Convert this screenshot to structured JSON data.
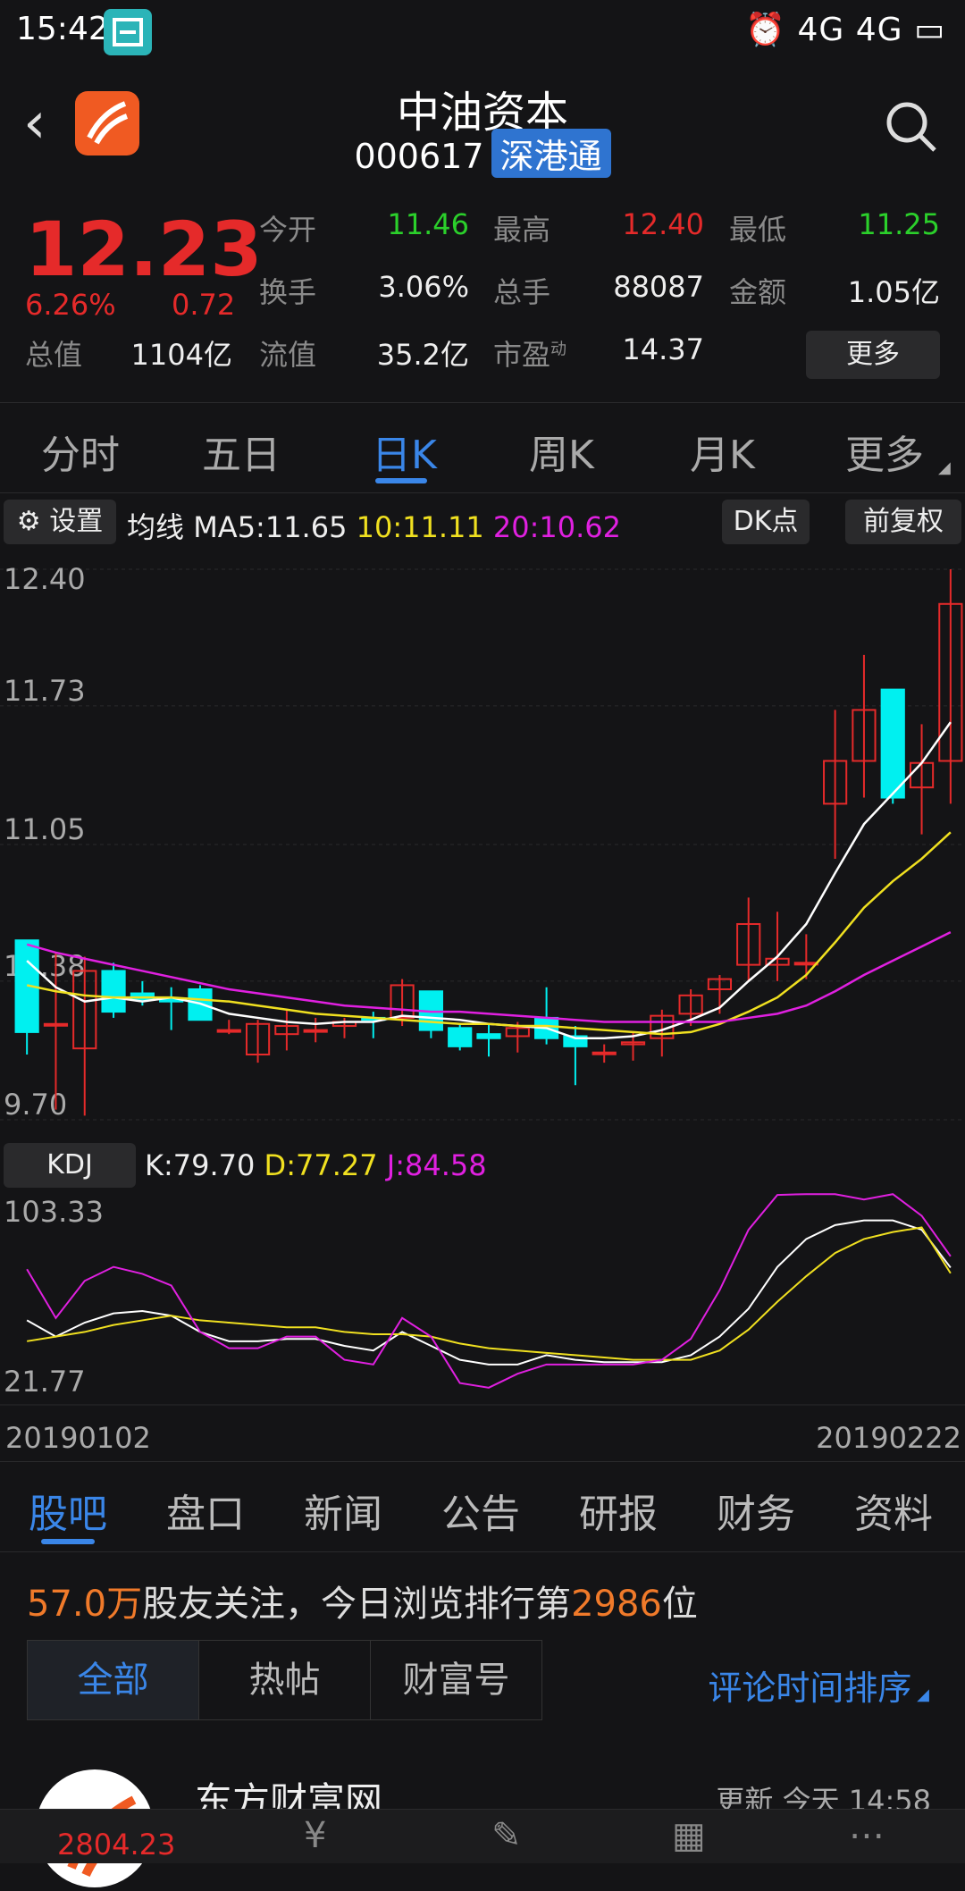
{
  "status_bar": {
    "time": "15:42",
    "right": "4G 4G"
  },
  "header": {
    "title": "中油资本",
    "code": "000617",
    "tag": "深港通"
  },
  "quote": {
    "price": "12.23",
    "change_pct": "6.26%",
    "change": "0.72",
    "open_label": "今开",
    "open": "11.46",
    "high_label": "最高",
    "high": "12.40",
    "low_label": "最低",
    "low": "11.25",
    "turnover_label": "换手",
    "turnover": "3.06%",
    "volume_label": "总手",
    "volume": "88087",
    "amount_label": "金额",
    "amount": "1.05亿",
    "mktcap_label": "总值",
    "mktcap": "1104亿",
    "float_label": "流值",
    "float": "35.2亿",
    "pe_label": "市盈",
    "pe_sup": "动",
    "pe": "14.37",
    "more": "更多"
  },
  "tabs": [
    "分时",
    "五日",
    "日K",
    "周K",
    "月K",
    "更多"
  ],
  "chart_toolbar": {
    "settings": "设置",
    "ma_label": "均线",
    "ma5": "MA5:11.65",
    "ma10": "10:11.11",
    "ma20": "20:10.62",
    "dk": "DK点",
    "adjust": "前复权"
  },
  "kdj_toolbar": {
    "label": "KDJ",
    "k": "K:79.70",
    "d": "D:77.27",
    "j": "J:84.58"
  },
  "dates": {
    "start": "20190102",
    "end": "20190222"
  },
  "colors": {
    "up": "#e52a2a",
    "down": "#00f0f0",
    "ma5": "#ffffff",
    "ma10": "#f0e020",
    "ma20": "#e020e0",
    "accent": "#3a86e8"
  },
  "chart_data": [
    {
      "type": "candlestick",
      "y_ticks": [
        "12.40",
        "11.73",
        "11.05",
        "10.38",
        "9.70"
      ],
      "ylim": [
        9.7,
        12.4
      ],
      "candles": [
        [
          10.58,
          10.58,
          10.02,
          10.13
        ],
        [
          10.17,
          10.52,
          9.75,
          10.17
        ],
        [
          10.05,
          10.5,
          9.72,
          10.43
        ],
        [
          10.43,
          10.47,
          10.2,
          10.23
        ],
        [
          10.32,
          10.38,
          10.26,
          10.29
        ],
        [
          10.29,
          10.35,
          10.14,
          10.28
        ],
        [
          10.34,
          10.36,
          10.19,
          10.19
        ],
        [
          10.14,
          10.19,
          10.12,
          10.14
        ],
        [
          10.02,
          10.19,
          9.98,
          10.17
        ],
        [
          10.12,
          10.24,
          10.04,
          10.16
        ],
        [
          10.14,
          10.2,
          10.08,
          10.14
        ],
        [
          10.16,
          10.2,
          10.1,
          10.18
        ],
        [
          10.2,
          10.23,
          10.1,
          10.19
        ],
        [
          10.2,
          10.39,
          10.16,
          10.36
        ],
        [
          10.33,
          10.33,
          10.1,
          10.14
        ],
        [
          10.15,
          10.17,
          10.04,
          10.06
        ],
        [
          10.12,
          10.17,
          10.01,
          10.1
        ],
        [
          10.11,
          10.18,
          10.03,
          10.15
        ],
        [
          10.2,
          10.35,
          10.07,
          10.1
        ],
        [
          10.11,
          10.16,
          9.87,
          10.06
        ],
        [
          10.03,
          10.07,
          9.98,
          10.03
        ],
        [
          10.07,
          10.13,
          9.99,
          10.08
        ],
        [
          10.1,
          10.24,
          10.01,
          10.21
        ],
        [
          10.22,
          10.34,
          10.16,
          10.31
        ],
        [
          10.34,
          10.41,
          10.22,
          10.39
        ],
        [
          10.46,
          10.79,
          10.38,
          10.66
        ],
        [
          10.46,
          10.72,
          10.38,
          10.49
        ],
        [
          10.47,
          10.61,
          10.39,
          10.47
        ],
        [
          11.25,
          11.71,
          10.98,
          11.46
        ],
        [
          11.46,
          11.98,
          11.28,
          11.71
        ],
        [
          11.81,
          11.81,
          11.25,
          11.28
        ],
        [
          11.33,
          11.64,
          11.1,
          11.45
        ],
        [
          11.46,
          12.4,
          11.25,
          12.23
        ]
      ],
      "ma5": [
        10.48,
        10.35,
        10.28,
        10.3,
        10.28,
        10.3,
        10.27,
        10.22,
        10.2,
        10.18,
        10.17,
        10.18,
        10.18,
        10.21,
        10.2,
        10.19,
        10.17,
        10.16,
        10.15,
        10.1,
        10.1,
        10.11,
        10.14,
        10.19,
        10.25,
        10.38,
        10.5,
        10.66,
        10.91,
        11.15,
        11.3,
        11.45,
        11.65
      ],
      "ma10": [
        10.36,
        10.33,
        10.31,
        10.3,
        10.3,
        10.3,
        10.29,
        10.28,
        10.26,
        10.24,
        10.22,
        10.21,
        10.2,
        10.19,
        10.18,
        10.17,
        10.17,
        10.16,
        10.16,
        10.15,
        10.14,
        10.13,
        10.12,
        10.13,
        10.17,
        10.23,
        10.3,
        10.41,
        10.57,
        10.74,
        10.87,
        10.98,
        11.11
      ],
      "ma20": [
        10.56,
        10.52,
        10.49,
        10.46,
        10.43,
        10.4,
        10.37,
        10.34,
        10.32,
        10.3,
        10.28,
        10.26,
        10.25,
        10.24,
        10.23,
        10.23,
        10.22,
        10.21,
        10.2,
        10.19,
        10.18,
        10.18,
        10.18,
        10.18,
        10.18,
        10.2,
        10.22,
        10.26,
        10.33,
        10.41,
        10.48,
        10.55,
        10.62
      ]
    },
    {
      "type": "line",
      "y_ticks": [
        "103.33",
        "21.77"
      ],
      "ylim": [
        21.77,
        103.33
      ],
      "series": [
        {
          "name": "K",
          "values": [
            57,
            50,
            56,
            60,
            61,
            59,
            52,
            48,
            48,
            49,
            49,
            46,
            44,
            52,
            46,
            40,
            38,
            38,
            42,
            40,
            39,
            39,
            39,
            42,
            50,
            62,
            80,
            92,
            98,
            100,
            100,
            96,
            79.7
          ]
        },
        {
          "name": "D",
          "values": [
            48,
            50,
            52,
            55,
            57,
            59,
            57,
            56,
            55,
            54,
            54,
            52,
            51,
            51,
            50,
            47,
            45,
            44,
            43,
            42,
            41,
            40,
            40,
            40,
            44,
            53,
            65,
            76,
            86,
            92,
            95,
            97,
            77.27
          ]
        },
        {
          "name": "J",
          "values": [
            79,
            58,
            74,
            80,
            77,
            72,
            52,
            45,
            45,
            50,
            50,
            40,
            38,
            58,
            50,
            30,
            28,
            34,
            38,
            38,
            38,
            38,
            40,
            49,
            70,
            96,
            111,
            115,
            116,
            109,
            113,
            102,
            84.58
          ]
        }
      ]
    }
  ],
  "bottom_tabs": [
    "股吧",
    "盘口",
    "新闻",
    "公告",
    "研报",
    "财务",
    "资料"
  ],
  "forum": {
    "fans": "57.0万",
    "fans_text": "股友关注，今日浏览排行第",
    "rank": "2986",
    "rank_unit": "位",
    "segments": [
      "全部",
      "热帖",
      "财富号"
    ],
    "sort": "评论时间排序"
  },
  "post": {
    "name": "东方财富网",
    "time": "更新 今天 14:58"
  },
  "bottom_bar": {
    "index": "2804.23"
  }
}
